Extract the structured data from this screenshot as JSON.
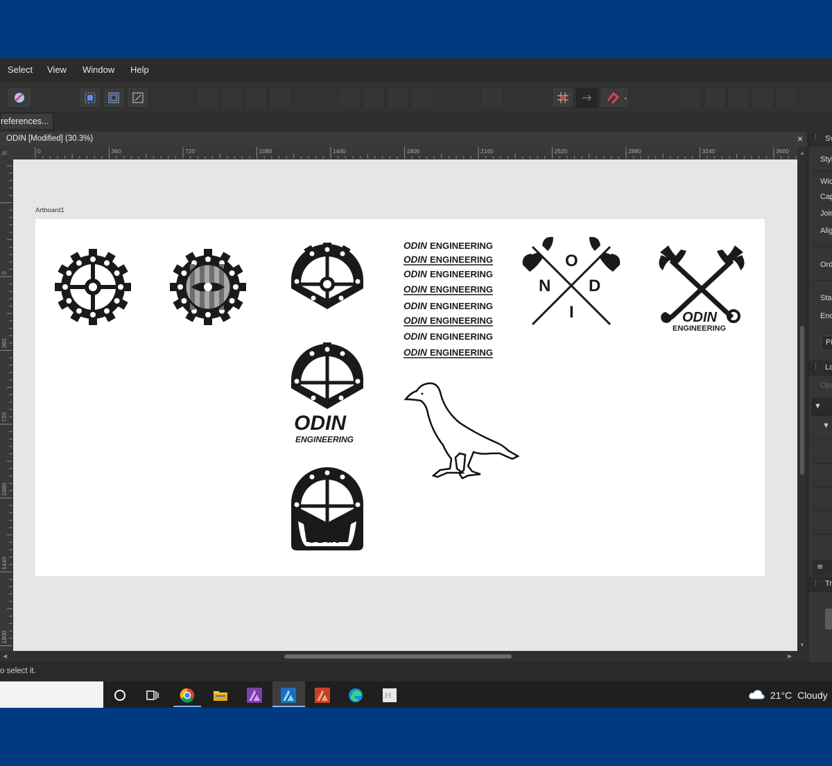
{
  "menu": {
    "items": [
      "Select",
      "View",
      "Window",
      "Help"
    ]
  },
  "context_bar": {
    "preferences_label": "references..."
  },
  "document": {
    "tab_title": "ODIN [Modified] (30.3%)",
    "close_glyph": "×"
  },
  "rulers": {
    "unit": "pt",
    "horizontal": [
      "0",
      "360",
      "720",
      "1080",
      "1440",
      "1800",
      "2160",
      "2520",
      "2880",
      "3240",
      "3600"
    ],
    "vertical": [
      "0",
      "360",
      "720",
      "1080",
      "1440",
      "1800"
    ]
  },
  "canvas": {
    "artboard_label": "Artboard1",
    "logo": {
      "wordmark": "ODIN",
      "subtitle": "ENGINEERING",
      "engineering_label": "ENGINEERING",
      "axe_letters": [
        "O",
        "N",
        "D",
        "I"
      ],
      "wordmark_rows": [
        "ENGINEERING",
        "ENGINEERING",
        "ENGINEERING",
        "ENGINEERING",
        "ENGINEERING",
        "ENGINEERING",
        "ENGINEERING",
        "ENGINEERING"
      ]
    }
  },
  "right_panel": {
    "tab_labels": [
      "Sv",
      "Styl",
      "Wid",
      "Cap",
      "Join",
      "Alig",
      "Ord",
      "Star",
      "End",
      "Pi",
      "La",
      "Opa",
      "Tr"
    ]
  },
  "status": {
    "text": "o select it."
  },
  "taskbar": {
    "apps": [
      "cortana-icon",
      "task-view-icon",
      "chrome-icon",
      "file-explorer-icon",
      "affinity-photo-icon",
      "affinity-designer-icon",
      "affinity-publisher-icon",
      "edge-icon",
      "font-app-icon"
    ],
    "weather_temp": "21°C",
    "weather_cond": "Cloudy"
  },
  "colors": {
    "desktop": "#003a80",
    "app_bg": "#2e2e2e",
    "canvas": "#e6e6e6",
    "artboard": "#ffffff",
    "accent": "#7fb5ff"
  }
}
